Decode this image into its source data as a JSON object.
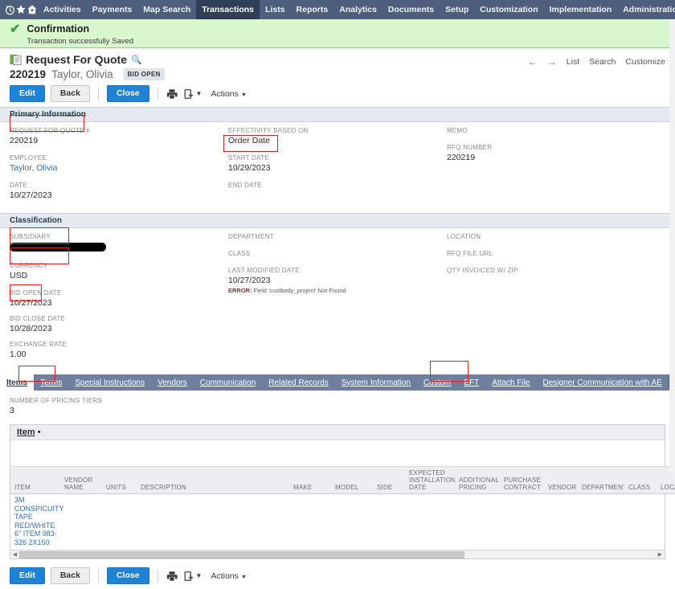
{
  "navbar": {
    "icons": [
      {
        "name": "history-icon",
        "glyph": "history"
      },
      {
        "name": "favorites-star-icon",
        "glyph": "star"
      },
      {
        "name": "home-icon",
        "glyph": "home"
      }
    ],
    "items": [
      {
        "label": "Activities",
        "active": false
      },
      {
        "label": "Payments",
        "active": false
      },
      {
        "label": "Map Search",
        "active": false
      },
      {
        "label": "Transactions",
        "active": true
      },
      {
        "label": "Lists",
        "active": false
      },
      {
        "label": "Reports",
        "active": false
      },
      {
        "label": "Analytics",
        "active": false
      },
      {
        "label": "Documents",
        "active": false
      },
      {
        "label": "Setup",
        "active": false
      },
      {
        "label": "Customization",
        "active": false
      },
      {
        "label": "Implementation",
        "active": false
      },
      {
        "label": "Administration and Controls",
        "active": false
      }
    ],
    "more_label": "•••",
    "bg_color": "#4d5f7d",
    "active_color": "#2f3f57"
  },
  "confirmation": {
    "title": "Confirmation",
    "message": "Transaction successfully Saved",
    "bg_color": "#d8f7cd",
    "check_color": "#3aa838"
  },
  "record": {
    "type_label": "Request For Quote",
    "id": "220219",
    "person": "Taylor, Olivia",
    "status": "BID OPEN",
    "search_icon": "search-icon"
  },
  "pagelinks": {
    "prev": "←",
    "next": "→",
    "list": "List",
    "search": "Search",
    "customize": "Customize"
  },
  "buttons": {
    "edit": "Edit",
    "back": "Back",
    "close": "Close",
    "print_icon": "printer-icon",
    "attach_icon": "attach-file-icon",
    "actions": "Actions"
  },
  "primary_information": {
    "section_title": "Primary Information",
    "col1": [
      {
        "label": "REQUEST FOR QUOTE #",
        "value": "220219",
        "link": false,
        "highlight": true
      },
      {
        "label": "EMPLOYEE",
        "value": "Taylor, Olivia",
        "link": true,
        "highlight": false
      },
      {
        "label": "DATE",
        "value": "10/27/2023",
        "link": false,
        "highlight": false
      }
    ],
    "col2": [
      {
        "label": "EFFECTIVITY BASED ON",
        "value": "Order Date",
        "link": false,
        "highlight": false
      },
      {
        "label": "START DATE",
        "value": "10/29/2023",
        "link": false,
        "highlight": true
      },
      {
        "label": "END DATE",
        "value": "",
        "link": false,
        "highlight": false
      }
    ],
    "col3": [
      {
        "label": "MEMO",
        "value": "",
        "link": false,
        "highlight": false
      },
      {
        "label": "RFQ NUMBER",
        "value": "220219",
        "link": false,
        "highlight": false
      }
    ]
  },
  "classification": {
    "section_title": "Classification",
    "col1": [
      {
        "label": "SUBSIDIARY",
        "value": "",
        "redacted": true,
        "highlight": false
      },
      {
        "label": "CURRENCY",
        "value": "USD",
        "redacted": false,
        "highlight": false
      },
      {
        "label": "BID OPEN DATE",
        "value": "10/27/2023",
        "redacted": false,
        "highlight": true
      },
      {
        "label": "BID CLOSE DATE",
        "value": "10/28/2023",
        "redacted": false,
        "highlight": true
      },
      {
        "label": "EXCHANGE RATE",
        "value": "1.00",
        "redacted": false,
        "highlight": false
      }
    ],
    "col2": [
      {
        "label": "DEPARTMENT",
        "value": "",
        "redacted": false,
        "highlight": false
      },
      {
        "label": "CLASS",
        "value": "",
        "redacted": false,
        "highlight": false
      },
      {
        "label": "LAST MODIFIED DATE",
        "value": "10/27/2023",
        "redacted": false,
        "highlight": false,
        "error_prefix": "ERROR:",
        "error_text": " Field 'custbody_project' Not Found"
      }
    ],
    "col3": [
      {
        "label": "LOCATION",
        "value": "",
        "redacted": false,
        "highlight": false
      },
      {
        "label": "RFQ FILE URL",
        "value": "",
        "redacted": false,
        "highlight": false
      },
      {
        "label": "QTY INVOICED W/ ZIP",
        "value": "",
        "redacted": false,
        "highlight": false
      }
    ]
  },
  "tabs": [
    {
      "label": "Items",
      "active": true
    },
    {
      "label": "Terms",
      "active": false
    },
    {
      "label": "Special Instructions",
      "active": false
    },
    {
      "label": "Vendors",
      "active": false
    },
    {
      "label": "Communication",
      "active": false
    },
    {
      "label": "Related Records",
      "active": false
    },
    {
      "label": "System Information",
      "active": false
    },
    {
      "label": "Custom",
      "active": false
    },
    {
      "label": "EFT",
      "active": false
    },
    {
      "label": "Attach File",
      "active": false
    },
    {
      "label": "Designer Communication with AE",
      "active": false
    }
  ],
  "tab_menu_icon": "list-menu-icon",
  "items_tab": {
    "pricing_tiers_label": "NUMBER OF PRICING TIERS",
    "pricing_tiers_value": "3",
    "sublist_title": "Item",
    "sublist_title_caret": "•",
    "columns": [
      "ITEM",
      "VENDOR NAME",
      "UNITS",
      "DESCRIPTION",
      "MAKE",
      "MODEL",
      "SIDE",
      "EXPECTED INSTALLATION DATE",
      "ADDITIONAL PRICING",
      "PURCHASE CONTRACT",
      "VENDOR",
      "DEPARTMENT",
      "CLASS",
      "LOCATION"
    ],
    "rows": [
      {
        "item": "3M CONSPICUITY TAPE RED/WHITE 6\" ITEM 983-326 2X150",
        "vendor_name": "",
        "units": "",
        "description": "",
        "make": "",
        "model": "",
        "side": "",
        "expected_installation_date": "",
        "additional_pricing": "",
        "purchase_contract": "",
        "vendor": "",
        "department": "",
        "class": "",
        "location": ""
      }
    ],
    "scroll_left_arrow": "◀",
    "scroll_right_arrow": "▶"
  }
}
